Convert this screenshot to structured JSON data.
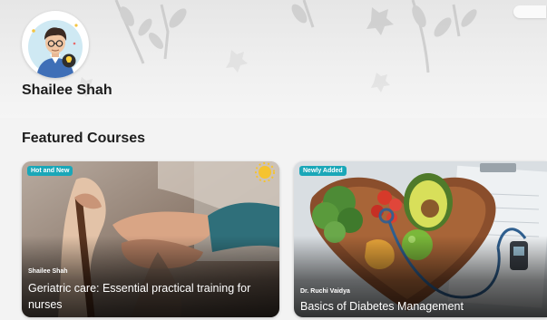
{
  "profile": {
    "name": "Shailee Shah",
    "avatar_icon": "user-avatar-icon"
  },
  "featured": {
    "heading": "Featured Courses",
    "courses": [
      {
        "badge": "Hot and New",
        "author": "Shailee Shah",
        "title": "Geriatric care: Essential practical training for nurses",
        "badge_color": "#1aa7b8"
      },
      {
        "badge": "Newly Added",
        "author": "Dr. Ruchi Vaidya",
        "title": "Basics of Diabetes Management",
        "badge_color": "#1aa7b8"
      }
    ]
  }
}
